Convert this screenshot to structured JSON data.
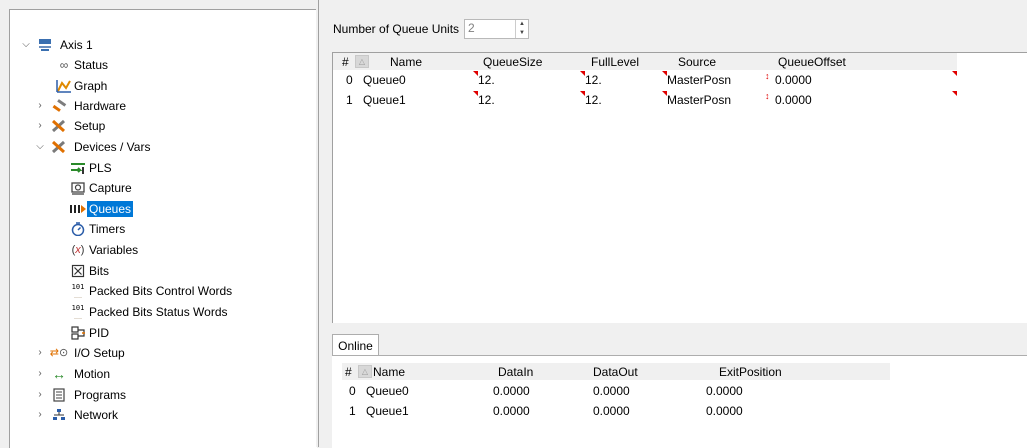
{
  "tree": {
    "root_label": "Axis 1",
    "items": [
      {
        "label": "Status"
      },
      {
        "label": "Graph"
      },
      {
        "label": "Hardware"
      },
      {
        "label": "Setup"
      },
      {
        "label": "Devices / Vars"
      },
      {
        "label": "PLS"
      },
      {
        "label": "Capture"
      },
      {
        "label": "Queues"
      },
      {
        "label": "Timers"
      },
      {
        "label": "Variables"
      },
      {
        "label": "Bits"
      },
      {
        "label": "Packed Bits Control Words"
      },
      {
        "label": "Packed Bits Status Words"
      },
      {
        "label": "PID"
      },
      {
        "label": "I/O Setup"
      },
      {
        "label": "Motion"
      },
      {
        "label": "Programs"
      },
      {
        "label": "Network"
      }
    ],
    "selected": "Queues"
  },
  "queue_units": {
    "label": "Number of Queue Units",
    "value": "2"
  },
  "queue_grid": {
    "headers": [
      "#",
      "Name",
      "QueueSize",
      "FullLevel",
      "Source",
      "QueueOffset"
    ],
    "rows": [
      [
        "0",
        "Queue0",
        "12.",
        "12.",
        "MasterPosn",
        "0.0000"
      ],
      [
        "1",
        "Queue1",
        "12.",
        "12.",
        "MasterPosn",
        "0.0000"
      ]
    ]
  },
  "online": {
    "tab_label": "Online",
    "headers": [
      "#",
      "Name",
      "DataIn",
      "DataOut",
      "ExitPosition"
    ],
    "rows": [
      [
        "0",
        "Queue0",
        "0.0000",
        "0.0000",
        "0.0000"
      ],
      [
        "1",
        "Queue1",
        "0.0000",
        "0.0000",
        "0.0000"
      ]
    ]
  },
  "colors": {
    "selection": "#0078d7",
    "flag": "#e00000"
  }
}
